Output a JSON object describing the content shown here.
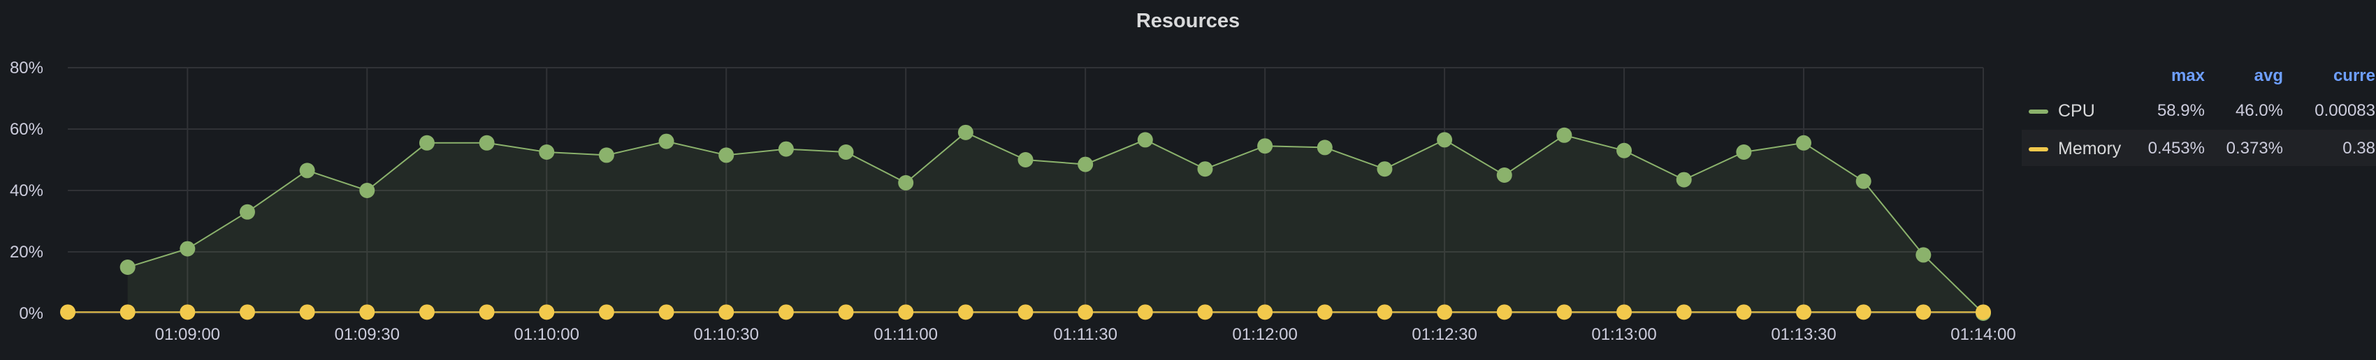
{
  "panel": {
    "title": "Resources"
  },
  "legend": {
    "headers": {
      "max": "max",
      "avg": "avg",
      "current": "curre"
    },
    "series": [
      {
        "name": "CPU",
        "color": "#8bb26c",
        "max": "58.9%",
        "avg": "46.0%",
        "current": "0.00083"
      },
      {
        "name": "Memory",
        "color": "#f2c94c",
        "max": "0.453%",
        "avg": "0.373%",
        "current": "0.38"
      }
    ]
  },
  "chart_data": {
    "type": "line",
    "title": "Resources",
    "xlabel": "",
    "ylabel": "",
    "grid": true,
    "legend_placement": "right",
    "y_axis": {
      "min": 0,
      "max": 80,
      "unit": "%",
      "ticks": [
        "0%",
        "20%",
        "40%",
        "60%",
        "80%"
      ]
    },
    "x_axis": {
      "start": "01:08:40",
      "end": "01:14:00",
      "ticks": [
        "01:09:00",
        "01:09:30",
        "01:10:00",
        "01:10:30",
        "01:11:00",
        "01:11:30",
        "01:12:00",
        "01:12:30",
        "01:13:00",
        "01:13:30",
        "01:14:00"
      ]
    },
    "x": [
      "01:08:40",
      "01:08:50",
      "01:09:00",
      "01:09:10",
      "01:09:20",
      "01:09:30",
      "01:09:40",
      "01:09:50",
      "01:10:00",
      "01:10:10",
      "01:10:20",
      "01:10:30",
      "01:10:40",
      "01:10:50",
      "01:11:00",
      "01:11:10",
      "01:11:20",
      "01:11:30",
      "01:11:40",
      "01:11:50",
      "01:12:00",
      "01:12:10",
      "01:12:20",
      "01:12:30",
      "01:12:40",
      "01:12:50",
      "01:13:00",
      "01:13:10",
      "01:13:20",
      "01:13:30",
      "01:13:40",
      "01:13:50",
      "01:14:00"
    ],
    "series": [
      {
        "name": "CPU",
        "color": "#8bb26c",
        "area": true,
        "values": [
          null,
          15,
          21,
          33,
          46.5,
          40,
          55.5,
          55.5,
          52.5,
          51.5,
          56,
          51.5,
          53.5,
          52.5,
          42.5,
          58.9,
          50,
          48.5,
          56.5,
          47,
          54.5,
          54,
          47,
          56.5,
          45,
          58,
          53,
          43.5,
          52.5,
          55.5,
          43,
          19,
          0.00083
        ]
      },
      {
        "name": "Memory",
        "color": "#f2c94c",
        "area": false,
        "values": [
          0.38,
          0.38,
          0.38,
          0.38,
          0.38,
          0.38,
          0.38,
          0.38,
          0.38,
          0.38,
          0.38,
          0.38,
          0.38,
          0.38,
          0.38,
          0.38,
          0.38,
          0.38,
          0.38,
          0.38,
          0.38,
          0.38,
          0.38,
          0.38,
          0.38,
          0.38,
          0.38,
          0.38,
          0.38,
          0.38,
          0.38,
          0.38,
          0.38
        ]
      }
    ]
  }
}
